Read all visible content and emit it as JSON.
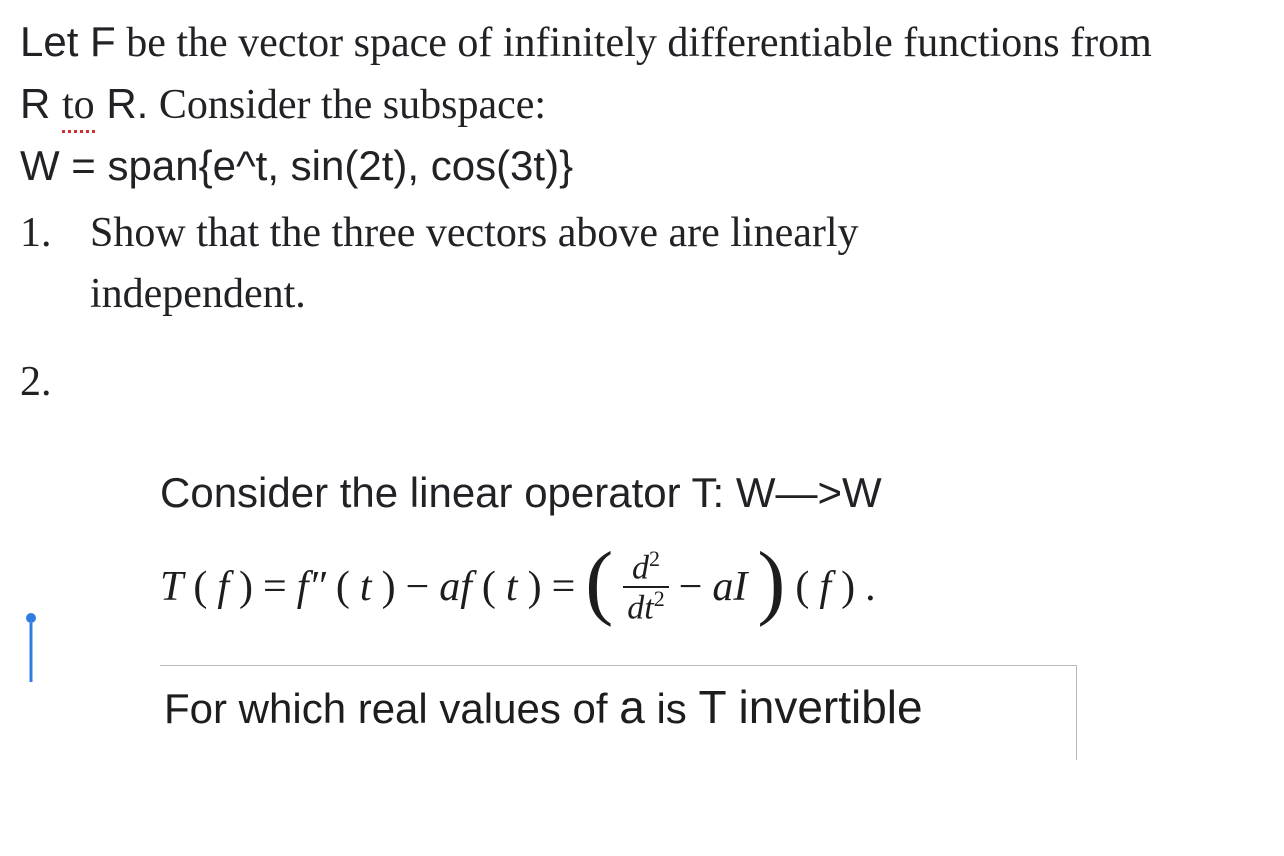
{
  "intro": {
    "line1_prefix_sans": "Let F",
    "line1_rest": " be the vector space of infinitely differentiable functions from",
    "line2_part1_sans": "R ",
    "line2_to": "to",
    "line2_part2_sans": " R.",
    "line2_rest": " Consider the subspace:",
    "line3_w_sans": "W = span{e^t, sin(2t), cos(3t)}"
  },
  "part1": {
    "num": "1.",
    "text_a": "Show that the three vectors above are linearly",
    "text_b": "independent."
  },
  "part2": {
    "num": "2.",
    "consider_prefix": "Consider the linear operator ",
    "consider_T": "T: W—>W",
    "formula": {
      "lhs_T": "T",
      "lhs_open": "(",
      "lhs_f": "f",
      "lhs_close": ")",
      "eq1": " = ",
      "fpp": "f″",
      "t_open": "(",
      "t_var": "t",
      "t_close": ")",
      "minus1": " − ",
      "af": "af",
      "eq2": " = ",
      "frac_num_d": "d",
      "frac_num_sup": "2",
      "frac_den_dt": "dt",
      "frac_den_sup": "2",
      "minus2": " − ",
      "aI": "aI",
      "after_paren_open": "(",
      "after_f": "f",
      "after_paren_close": ")",
      "period": "."
    },
    "last_prefix": "For which real values of ",
    "last_a": "a",
    "last_mid": " is ",
    "last_T": "T invertible"
  }
}
